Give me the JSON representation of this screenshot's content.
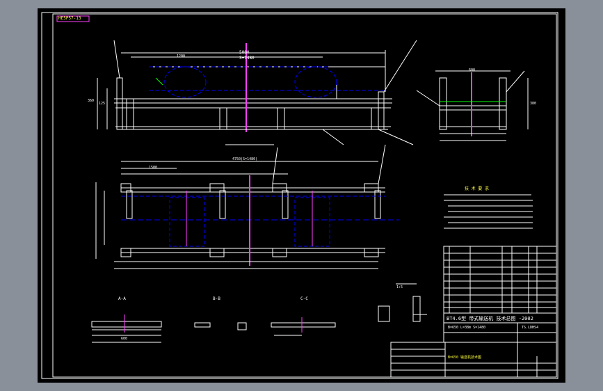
{
  "drawing": {
    "stamp": "HE5P57-13",
    "title_block": {
      "title": "BT4.6型 带式输送机 技术总图 -2002",
      "row2_left": "B=650 L=38m S=1480",
      "row2_right": "TS.LDHS4",
      "row3": "B=650 输送机技术图"
    },
    "views": {
      "a": "A-A",
      "b": "B-B",
      "c": "C-C",
      "scale": "1:5"
    },
    "dims": {
      "top_overall": "5000",
      "top_span": "S=1480",
      "left_h1": "360",
      "left_h2": "125",
      "mid_len": "1200",
      "plan_overall": "4750(S=1480)",
      "plan_sub": "1500",
      "side_w": "600",
      "side_h": "380",
      "base": "600"
    },
    "notes_title": "技 术 要 求"
  }
}
